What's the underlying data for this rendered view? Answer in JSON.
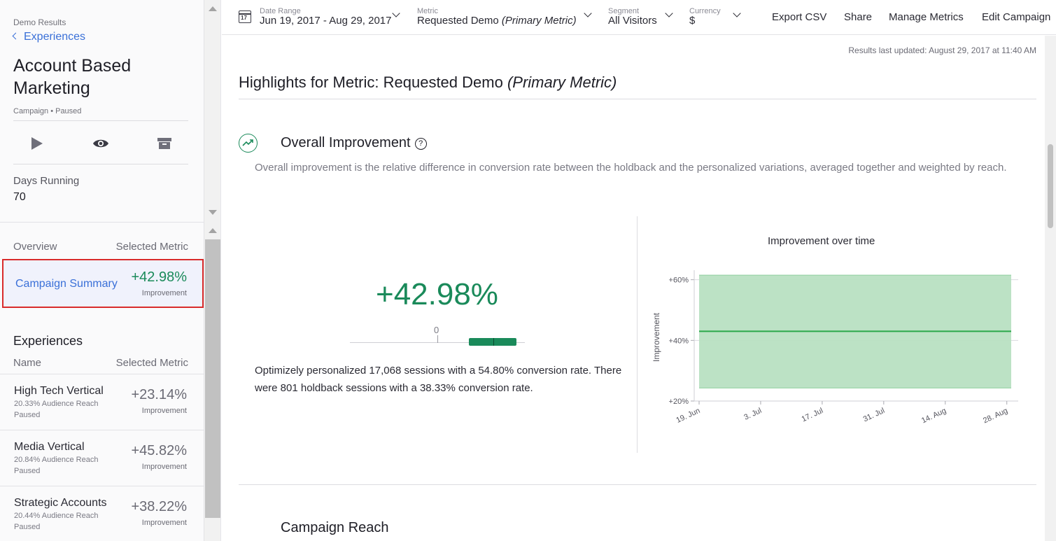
{
  "sidebar": {
    "breadcrumb": "Demo Results",
    "back_link": "Experiences",
    "title": "Account Based Marketing",
    "meta": "Campaign • Paused",
    "actions": [
      "play-icon",
      "eye-icon",
      "archive-icon"
    ],
    "days_running_label": "Days Running",
    "days_running_value": "70",
    "overview_label": "Overview",
    "selected_metric_label": "Selected Metric",
    "summary": {
      "label": "Campaign Summary",
      "value": "+42.98%",
      "sub": "Improvement"
    },
    "experiences_title": "Experiences",
    "name_label": "Name",
    "experiences": [
      {
        "name": "High Tech Vertical",
        "reach": "20.33% Audience Reach",
        "status": "Paused",
        "value": "+23.14%",
        "sub": "Improvement"
      },
      {
        "name": "Media Vertical",
        "reach": "20.84% Audience Reach",
        "status": "Paused",
        "value": "+45.82%",
        "sub": "Improvement"
      },
      {
        "name": "Strategic Accounts",
        "reach": "20.44% Audience Reach",
        "status": "Paused",
        "value": "+38.22%",
        "sub": "Improvement"
      }
    ]
  },
  "topbar": {
    "date_range": {
      "caption": "Date Range",
      "value": "Jun 19, 2017 - Aug 29, 2017",
      "icon_text": "17"
    },
    "metric": {
      "caption": "Metric",
      "value": "Requested Demo",
      "value_em": "(Primary Metric)"
    },
    "segment": {
      "caption": "Segment",
      "value": "All Visitors"
    },
    "currency": {
      "caption": "Currency",
      "value": "$"
    },
    "links": [
      "Export CSV",
      "Share",
      "Manage Metrics",
      "Edit Campaign"
    ]
  },
  "main": {
    "updated": "Results last updated: August 29, 2017 at 11:40 AM",
    "highlights_prefix": "Highlights for Metric: Requested Demo",
    "highlights_em": "(Primary Metric)",
    "overall_title": "Overall Improvement",
    "help_glyph": "?",
    "overall_desc": "Overall improvement is the relative difference in conversion rate between the holdback and the personalized variations, averaged together and weighted by reach.",
    "big_value": "+42.98%",
    "zero_label": "0",
    "sessions_text": "Optimizely personalized 17,068 sessions with a 54.80% conversion rate. There were 801 holdback sessions with a 38.33% conversion rate.",
    "chart_title": "Improvement over time",
    "campaign_reach_title": "Campaign Reach"
  },
  "colors": {
    "accent_blue": "#3a70d8",
    "positive_green": "#1a8a5a",
    "band_green": "#b8e0c2",
    "highlight_border": "#d92b2b"
  },
  "chart_data": {
    "type": "area",
    "title": "Improvement over time",
    "ylabel": "Improvement",
    "y_ticks": [
      "+20%",
      "+40%",
      "+60%"
    ],
    "ylim": [
      20,
      62
    ],
    "x_ticks": [
      "19. Jun",
      "3. Jul",
      "17. Jul",
      "31. Jul",
      "14. Aug",
      "28. Aug"
    ],
    "x_range": [
      "2017-06-19",
      "2017-08-29"
    ],
    "series": [
      {
        "x": [
          "2017-06-19",
          "2017-08-29"
        ],
        "y": [
          42.98,
          42.98
        ]
      },
      {
        "x": [
          "2017-06-19",
          "2017-08-29"
        ],
        "upper": [
          61.5,
          61.5
        ],
        "lower": [
          24.3,
          24.3
        ]
      }
    ]
  }
}
